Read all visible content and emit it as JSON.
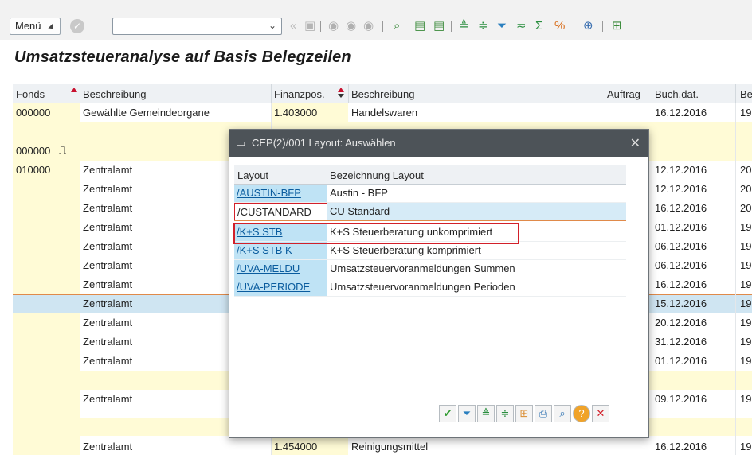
{
  "toolbar": {
    "menu_label": "Menü",
    "icons": [
      "save-icon",
      "back-icon",
      "exit-icon",
      "cancel-icon",
      "find-icon",
      "find-next-icon",
      "sort-asc-icon",
      "sort-desc-icon",
      "filter-icon",
      "set-filter-icon",
      "sum-icon",
      "export-icon",
      "layout-icon",
      "print-icon"
    ]
  },
  "page_title": "Umsatzsteueranalyse auf Basis Belegzeilen",
  "table": {
    "headers": [
      "Fonds",
      "Beschreibung",
      "Finanzpos.",
      "Beschreibung",
      "Auftrag",
      "Buch.dat.",
      "Be"
    ],
    "rows": [
      {
        "fonds": "000000",
        "beschreibung": "Gewählte Gemeindeorgane",
        "finanzpos": "1.403000",
        "beschreibung2": "Handelswaren",
        "auftrag": "",
        "buchdat": "16.12.2016",
        "be": "19"
      },
      {
        "fonds": "",
        "beschreibung": "",
        "finanzpos": "",
        "beschreibung2": "",
        "auftrag": "",
        "buchdat": "",
        "be": ""
      },
      {
        "fonds": "000000",
        "beschreibung": "",
        "finanzpos": "",
        "beschreibung2": "",
        "auftrag": "",
        "buchdat": "",
        "be": ""
      },
      {
        "fonds": "010000",
        "beschreibung": "Zentralamt",
        "finanzpos": "",
        "beschreibung2": "",
        "auftrag": "",
        "buchdat": "12.12.2016",
        "be": "20"
      },
      {
        "fonds": "",
        "beschreibung": "Zentralamt",
        "finanzpos": "",
        "beschreibung2": "",
        "auftrag": "",
        "buchdat": "12.12.2016",
        "be": "20"
      },
      {
        "fonds": "",
        "beschreibung": "Zentralamt",
        "finanzpos": "",
        "beschreibung2": "",
        "auftrag": "",
        "buchdat": "16.12.2016",
        "be": "20"
      },
      {
        "fonds": "",
        "beschreibung": "Zentralamt",
        "finanzpos": "",
        "beschreibung2": "",
        "auftrag": "",
        "buchdat": "01.12.2016",
        "be": "19"
      },
      {
        "fonds": "",
        "beschreibung": "Zentralamt",
        "finanzpos": "",
        "beschreibung2": "",
        "auftrag": "",
        "buchdat": "06.12.2016",
        "be": "19"
      },
      {
        "fonds": "",
        "beschreibung": "Zentralamt",
        "finanzpos": "",
        "beschreibung2": "",
        "auftrag": "",
        "buchdat": "06.12.2016",
        "be": "19"
      },
      {
        "fonds": "",
        "beschreibung": "Zentralamt",
        "finanzpos": "",
        "beschreibung2": "",
        "auftrag": "",
        "buchdat": "16.12.2016",
        "be": "19"
      },
      {
        "fonds": "",
        "beschreibung": "Zentralamt",
        "finanzpos": "",
        "beschreibung2": "",
        "auftrag": "",
        "buchdat": "15.12.2016",
        "be": "19"
      },
      {
        "fonds": "",
        "beschreibung": "Zentralamt",
        "finanzpos": "",
        "beschreibung2": "",
        "auftrag": "",
        "buchdat": "20.12.2016",
        "be": "19"
      },
      {
        "fonds": "",
        "beschreibung": "Zentralamt",
        "finanzpos": "",
        "beschreibung2": "",
        "auftrag": "",
        "buchdat": "31.12.2016",
        "be": "19"
      },
      {
        "fonds": "",
        "beschreibung": "Zentralamt",
        "finanzpos": "",
        "beschreibung2": "",
        "auftrag": "",
        "buchdat": "01.12.2016",
        "be": "19"
      },
      {
        "fonds": "",
        "beschreibung": "",
        "finanzpos": "",
        "beschreibung2": "",
        "auftrag": "",
        "buchdat": "",
        "be": ""
      },
      {
        "fonds": "",
        "beschreibung": "Zentralamt",
        "finanzpos": "",
        "beschreibung2": "",
        "auftrag": "",
        "buchdat": "09.12.2016",
        "be": "19"
      },
      {
        "fonds": "",
        "beschreibung": "",
        "finanzpos": "",
        "beschreibung2": "",
        "auftrag": "",
        "buchdat": "",
        "be": ""
      },
      {
        "fonds": "",
        "beschreibung": "Zentralamt",
        "finanzpos": "1.454000",
        "beschreibung2": "Reinigungsmittel",
        "auftrag": "",
        "buchdat": "16.12.2016",
        "be": "19"
      }
    ]
  },
  "dialog": {
    "title": "CEP(2)/001 Layout: Auswählen",
    "headers": [
      "Layout",
      "Bezeichnung Layout"
    ],
    "rows": [
      {
        "layout": "/AUSTIN-BFP",
        "bezeichnung": "Austin - BFP"
      },
      {
        "layout": "/CUSTANDARD",
        "bezeichnung": "CU Standard"
      },
      {
        "layout": "/K+S STB",
        "bezeichnung": "K+S Steuerberatung unkomprimiert"
      },
      {
        "layout": "/K+S STB K",
        "bezeichnung": "K+S Steuerberatung komprimiert"
      },
      {
        "layout": "/UVA-MELDU",
        "bezeichnung": "Umsatzsteuervoranmeldungen Summen"
      },
      {
        "layout": "/UVA-PERIODE",
        "bezeichnung": "Umsatzsteuervoranmeldungen Perioden"
      }
    ],
    "buttons": [
      "ok-icon",
      "filter-icon",
      "sort-asc-icon",
      "sort-desc-icon",
      "layout-grid-icon",
      "print-icon",
      "find-icon",
      "help-icon",
      "cancel-icon"
    ]
  },
  "colors": {
    "accent_red": "#d2202a",
    "selection_blue": "#cfe5f2",
    "key_column_blue": "#bfe3f5",
    "total_yellow": "#fffbd6",
    "dialog_title_bar": "#4d5358"
  }
}
